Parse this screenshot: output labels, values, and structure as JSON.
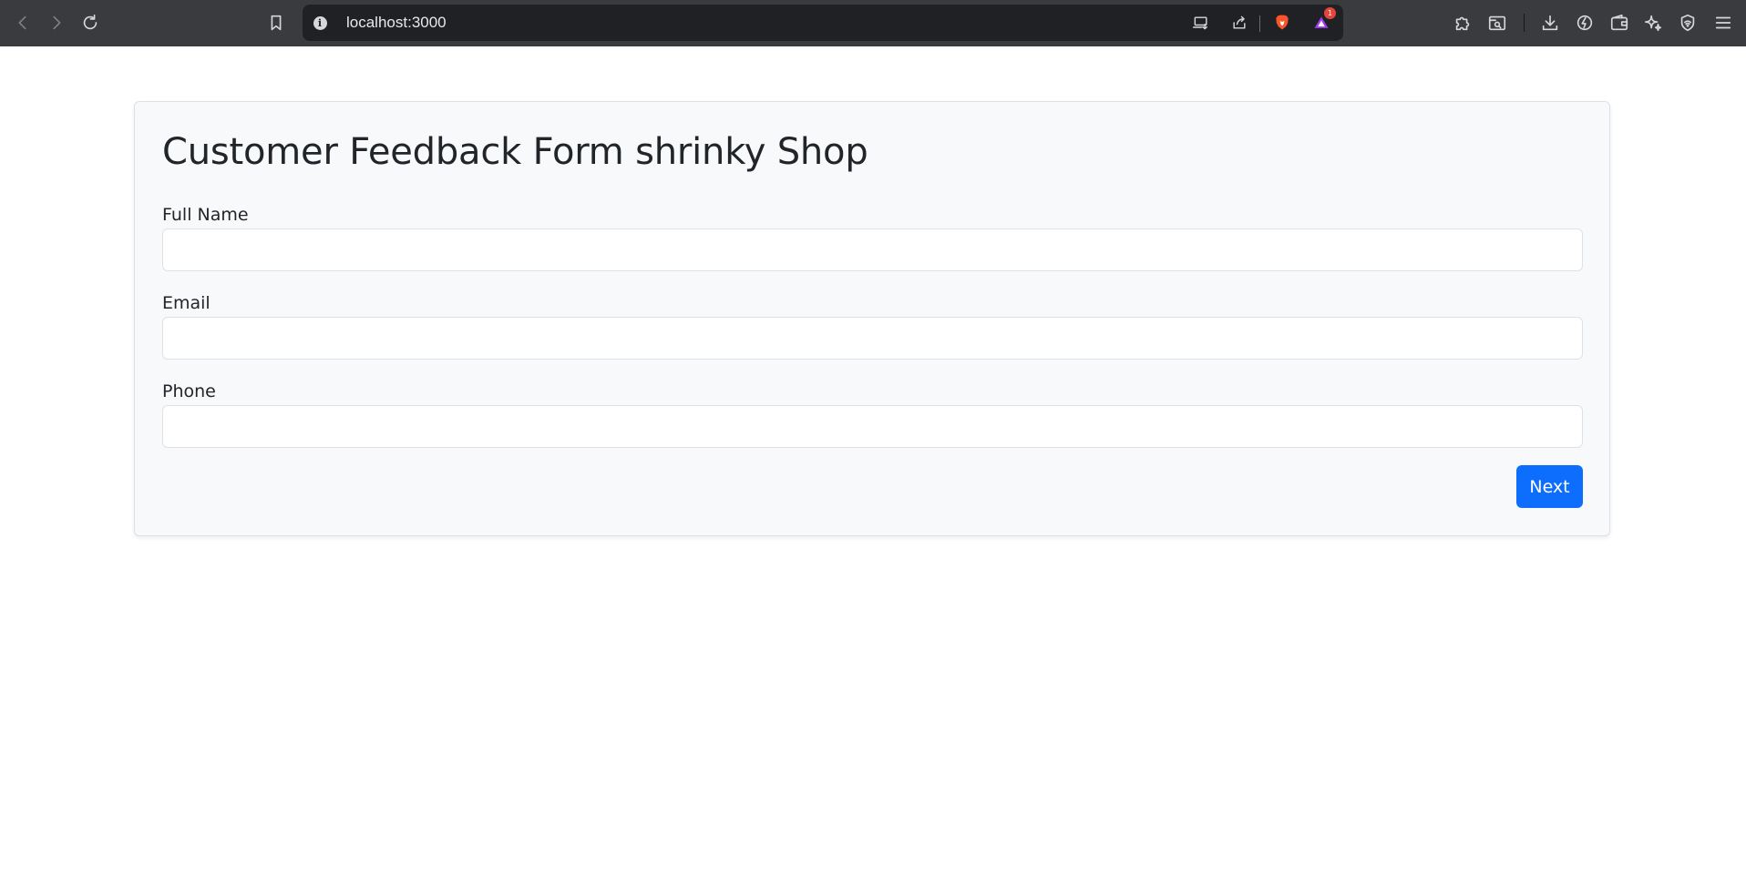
{
  "browser": {
    "url": "localhost:3000",
    "extension_badge_count": "1",
    "icons": {
      "back": "back-arrow-icon",
      "forward": "forward-arrow-icon",
      "reload": "reload-icon",
      "bookmark": "bookmark-icon",
      "site_info": "info-icon",
      "cast": "cast-icon",
      "share": "share-icon",
      "brave_shields": "brave-lion-icon",
      "brave_rewards": "brave-rewards-icon",
      "extensions": "puzzle-icon",
      "search_tab": "search-tab-icon",
      "downloads": "download-icon",
      "speedreader": "speedreader-icon",
      "wallet": "wallet-icon",
      "leo_ai": "sparkle-icon",
      "vpn": "vpn-shield-icon",
      "menu": "hamburger-menu-icon"
    },
    "colors": {
      "toolbar": "#3a3b3f",
      "urlbar": "#202124",
      "brave_orange": "#fb542b",
      "badge": "#e5443b"
    }
  },
  "form": {
    "title": "Customer Feedback Form shrinky Shop",
    "fields": [
      {
        "label": "Full Name",
        "value": "",
        "placeholder": ""
      },
      {
        "label": "Email",
        "value": "",
        "placeholder": ""
      },
      {
        "label": "Phone",
        "value": "",
        "placeholder": ""
      }
    ],
    "next_label": "Next",
    "colors": {
      "primary": "#0d6efd",
      "card_bg": "#f8f9fa",
      "text": "#212529"
    }
  }
}
